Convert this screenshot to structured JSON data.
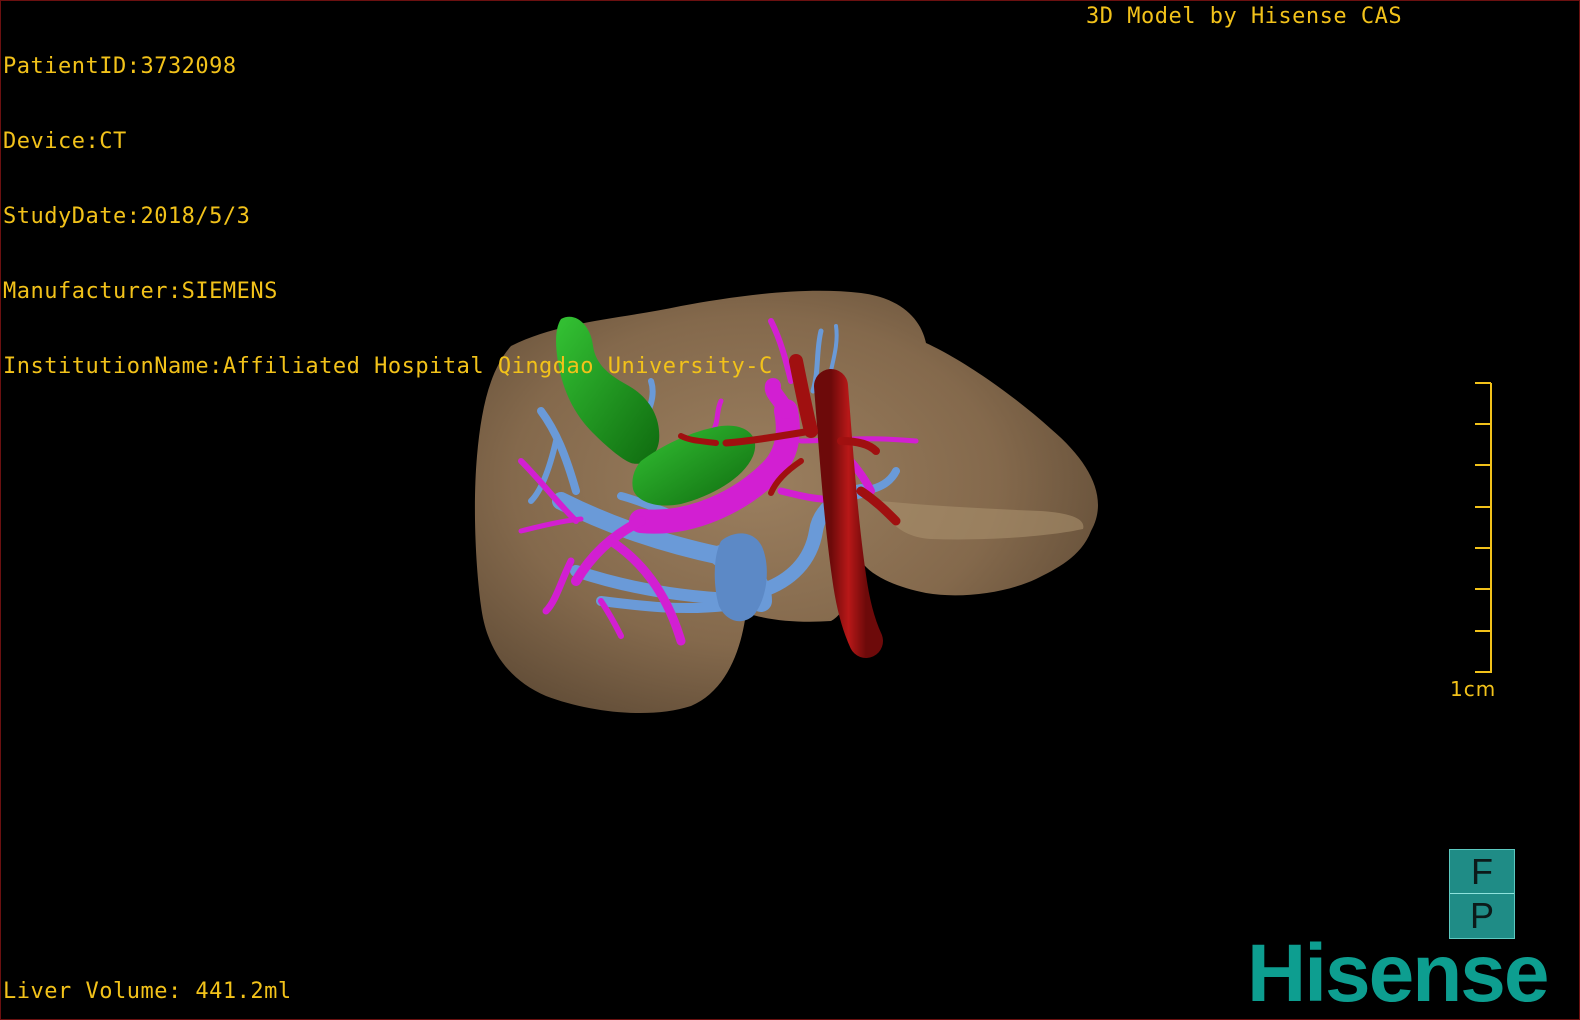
{
  "patient_info": {
    "patient_id": "PatientID:3732098",
    "device": "Device:CT",
    "study_date": "StudyDate:2018/5/3",
    "manufacturer": "Manufacturer:SIEMENS",
    "institution": "InstitutionName:Affiliated Hospital Qingdao University-C"
  },
  "brand_caption": "3D Model by Hisense CAS",
  "liver_volume": "Liver Volume: 441.2ml",
  "scale_label": "1cm",
  "orientation": {
    "top_face": "F",
    "bottom_face": "P"
  },
  "logo_text": "Hisense",
  "colors": {
    "overlay_text": "#f2c21a",
    "liver": "#8a6f52",
    "gallbladder": "#1e8f1e",
    "portal_vein": "#d21fd2",
    "hepatic_vein": "#6a9ad8",
    "artery": "#a01010",
    "logo": "#0d9e90"
  }
}
